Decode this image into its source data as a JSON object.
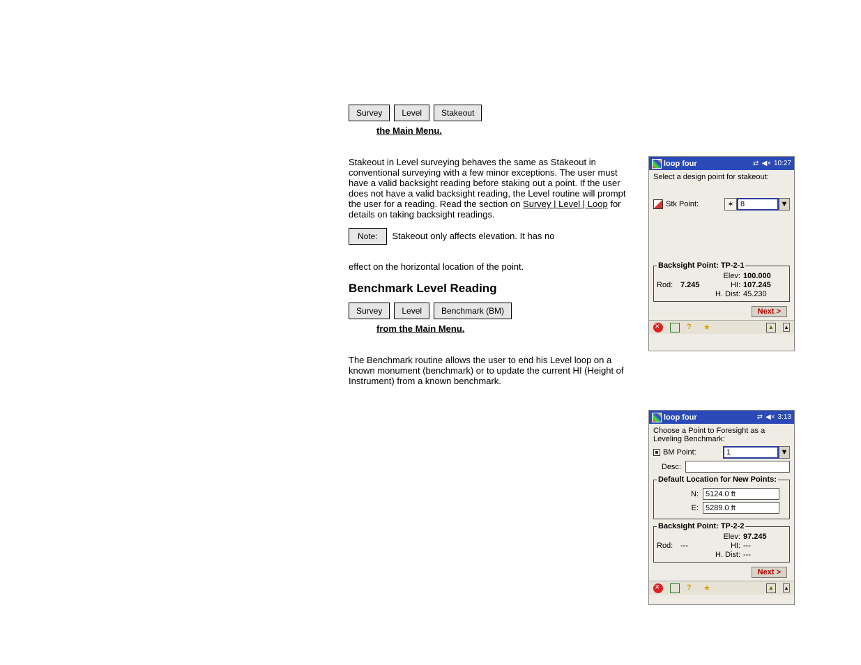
{
  "left": {
    "menu1": {
      "a": "Survey",
      "b": "Level",
      "c": "Stakeout",
      "caption": "the Main Menu."
    },
    "para1a": "Stakeout in Level surveying behaves the same as Stakeout in conventional surveying with a few minor exceptions. The user must have a valid backsight reading before staking out a point. If the user does not have a valid backsight reading, the Level routine will prompt the user for a reading. Read the section on ",
    "para1link": "Survey | Level | Loop",
    "para1b": " for details on taking backsight readings.",
    "noteChip": "Note:",
    "noteText": " Stakeout only affects elevation. It has no",
    "para2": "effect on the horizontal location of the point.",
    "menu2": {
      "a": "Survey",
      "b": "Level",
      "c": "Benchmark (BM)",
      "caption": "from the Main Menu."
    },
    "para3": "The Benchmark routine allows the user to end his Level loop on a known monument (benchmark) or to update the current HI (Height of Instrument) from a known benchmark.",
    "section": "Benchmark Level Reading"
  },
  "pda1": {
    "title": "loop four",
    "clock": "10:27",
    "instr": "Select a design point for stakeout:",
    "stkLabel": "Stk Point:",
    "stkValue": "8",
    "bsLegend": "Backsight Point: TP-2-1",
    "rodLabel": "Rod:",
    "rodVal": "7.245",
    "elevLabel": "Elev:",
    "elevVal": "100.000",
    "hiLabel": "HI:",
    "hiVal": "107.245",
    "hdLabel": "H. Dist:",
    "hdVal": "45.230",
    "next": "Next >"
  },
  "pda2": {
    "title": "loop four",
    "clock": "3:13",
    "instr": "Choose a Point to Foresight as a Leveling Benchmark:",
    "bmLabel": "BM Point:",
    "bmValue": "1",
    "descLabel": "Desc:",
    "descValue": "",
    "defLegend": "Default Location for New Points:",
    "nLabel": "N:",
    "nVal": "5124.0 ft",
    "eLabel": "E:",
    "eVal": "5289.0 ft",
    "bsLegend": "Backsight Point: TP-2-2",
    "rodLabel": "Rod:",
    "rodVal": "---",
    "elevLabel": "Elev:",
    "elevVal": "97.245",
    "hiLabel": "HI:",
    "hiVal": "---",
    "hdLabel": "H. Dist:",
    "hdVal": "---",
    "next": "Next >"
  }
}
